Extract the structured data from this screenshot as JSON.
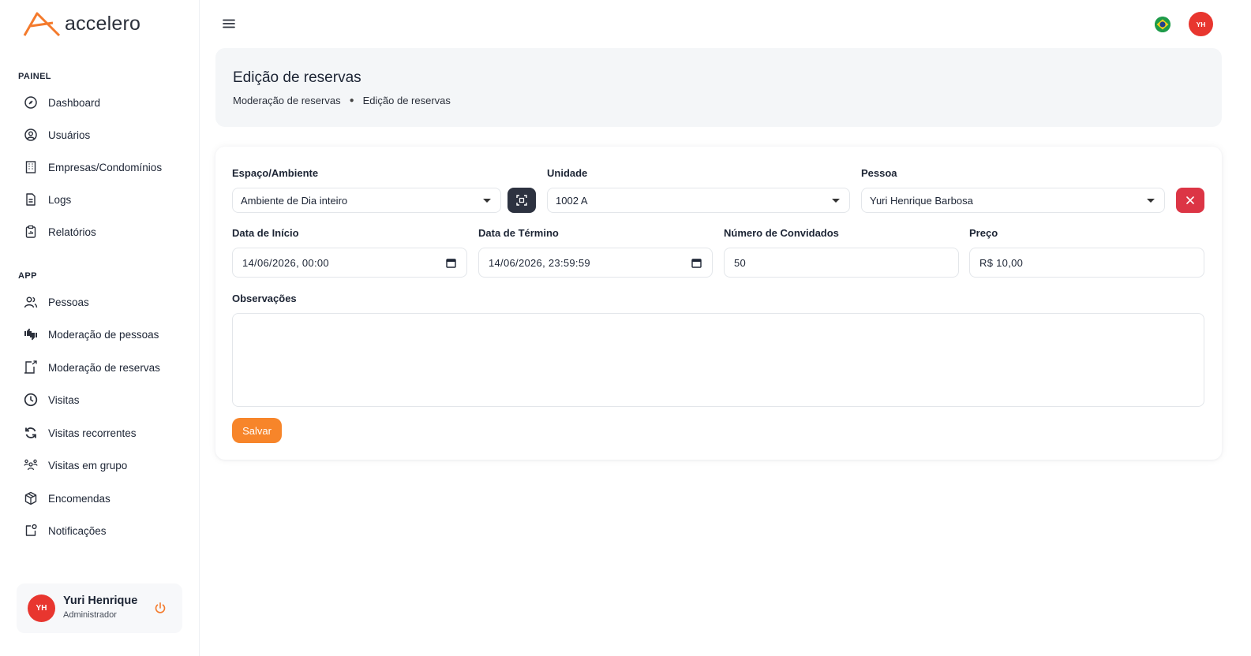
{
  "app": {
    "name": "accelero",
    "brand_color": "#f47a2c"
  },
  "sidebar": {
    "sections": [
      {
        "title": "PAINEL"
      },
      {
        "title": "APP"
      }
    ],
    "items": [
      {
        "label": "Dashboard",
        "icon": "dashboard-gauge-icon"
      },
      {
        "label": "Usuários",
        "icon": "user-circle-icon"
      },
      {
        "label": "Empresas/Condomínios",
        "icon": "building-icon"
      },
      {
        "label": "Logs",
        "icon": "file-icon"
      },
      {
        "label": "Relatórios",
        "icon": "clipboard-report-icon"
      },
      {
        "label": "Pessoas",
        "icon": "people-icon"
      },
      {
        "label": "Moderação de pessoas",
        "icon": "thumbs-up-down-icon"
      },
      {
        "label": "Moderação de reservas",
        "icon": "door-exit-icon"
      },
      {
        "label": "Visitas",
        "icon": "clock-icon"
      },
      {
        "label": "Visitas recorrentes",
        "icon": "refresh-icon"
      },
      {
        "label": "Visitas em grupo",
        "icon": "group-icon"
      },
      {
        "label": "Encomendas",
        "icon": "package-icon"
      },
      {
        "label": "Notificações",
        "icon": "notification-icon"
      }
    ],
    "user": {
      "initials": "YH",
      "name": "Yuri Henrique",
      "role": "Administrador"
    }
  },
  "header": {
    "avatar_initials": "YH",
    "language_flag": "brazil-flag-icon"
  },
  "page": {
    "title": "Edição de reservas",
    "breadcrumb": [
      "Moderação de reservas",
      "Edição de reservas"
    ]
  },
  "form": {
    "espaco": {
      "label": "Espaço/Ambiente",
      "value": "Ambiente de Dia inteiro"
    },
    "unidade": {
      "label": "Unidade",
      "value": "1002 A"
    },
    "pessoa": {
      "label": "Pessoa",
      "value": "Yuri Henrique Barbosa"
    },
    "data_inicio": {
      "label": "Data de Início",
      "value": "14/06/2026, 00:00"
    },
    "data_termino": {
      "label": "Data de Término",
      "value": "14/06/2026, 23:59:59"
    },
    "convidados": {
      "label": "Número de Convidados",
      "value": "50"
    },
    "preco": {
      "label": "Preço",
      "value": "R$ 10,00"
    },
    "observacoes": {
      "label": "Observações",
      "value": ""
    },
    "save_label": "Salvar"
  },
  "colors": {
    "avatar": "#e8362f",
    "save": "#f7852a",
    "danger": "#dc3545",
    "dark_btn": "#2d3240"
  }
}
